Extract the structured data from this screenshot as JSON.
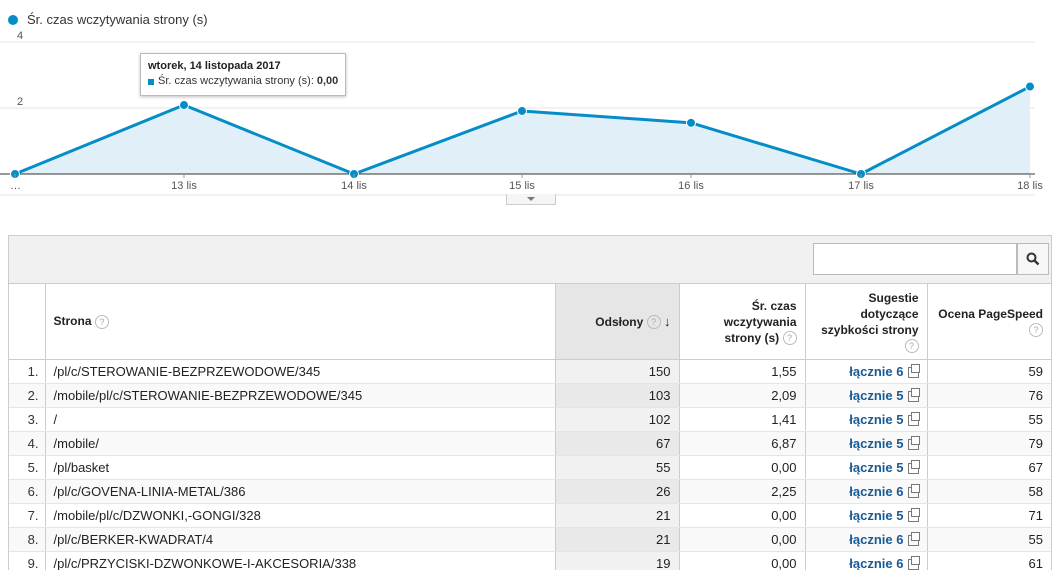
{
  "chart_data": {
    "type": "area",
    "series": [
      {
        "name": "Śr. czas wczytywania strony (s)",
        "values": [
          0.0,
          2.09,
          0.0,
          1.91,
          1.55,
          0.0,
          2.65
        ]
      }
    ],
    "categories": [
      "…",
      "13 lis",
      "14 lis",
      "15 lis",
      "16 lis",
      "17 lis",
      "18 lis"
    ],
    "y_ticks": [
      "4",
      "2"
    ],
    "ylim": [
      0,
      4
    ],
    "color": "#058dc7",
    "fill": "#e1eff8",
    "legend_label": "Śr. czas wczytywania strony (s)"
  },
  "tooltip": {
    "title": "wtorek, 14 listopada 2017",
    "label": "Śr. czas wczytywania strony (s):",
    "value": "0,00"
  },
  "table": {
    "headers": {
      "page": "Strona",
      "views": "Odsłony",
      "load_time": "Śr. czas wczytywania strony (s)",
      "suggestions": "Sugestie dotyczące szybkości strony",
      "pagespeed": "Ocena PageSpeed"
    },
    "rows": [
      {
        "idx": "1.",
        "page": "/pl/c/STEROWANIE-BEZPRZEWODOWE/345",
        "views": "150",
        "load": "1,55",
        "sugg": "łącznie 6",
        "score": "59"
      },
      {
        "idx": "2.",
        "page": "/mobile/pl/c/STEROWANIE-BEZPRZEWODOWE/345",
        "views": "103",
        "load": "2,09",
        "sugg": "łącznie 5",
        "score": "76"
      },
      {
        "idx": "3.",
        "page": "/",
        "views": "102",
        "load": "1,41",
        "sugg": "łącznie 5",
        "score": "55"
      },
      {
        "idx": "4.",
        "page": "/mobile/",
        "views": "67",
        "load": "6,87",
        "sugg": "łącznie 5",
        "score": "79"
      },
      {
        "idx": "5.",
        "page": "/pl/basket",
        "views": "55",
        "load": "0,00",
        "sugg": "łącznie 5",
        "score": "67"
      },
      {
        "idx": "6.",
        "page": "/pl/c/GOVENA-LINIA-METAL/386",
        "views": "26",
        "load": "2,25",
        "sugg": "łącznie 6",
        "score": "58"
      },
      {
        "idx": "7.",
        "page": "/mobile/pl/c/DZWONKI,-GONGI/328",
        "views": "21",
        "load": "0,00",
        "sugg": "łącznie 5",
        "score": "71"
      },
      {
        "idx": "8.",
        "page": "/pl/c/BERKER-KWADRAT/4",
        "views": "21",
        "load": "0,00",
        "sugg": "łącznie 6",
        "score": "55"
      },
      {
        "idx": "9.",
        "page": "/pl/c/PRZYCISKI-DZWONKOWE-I-AKCESORIA/338",
        "views": "19",
        "load": "0,00",
        "sugg": "łącznie 6",
        "score": "61"
      }
    ]
  },
  "icons": {
    "search": "search-icon",
    "help": "help-icon",
    "external": "external-link-icon",
    "sort": "sort-desc-icon"
  }
}
